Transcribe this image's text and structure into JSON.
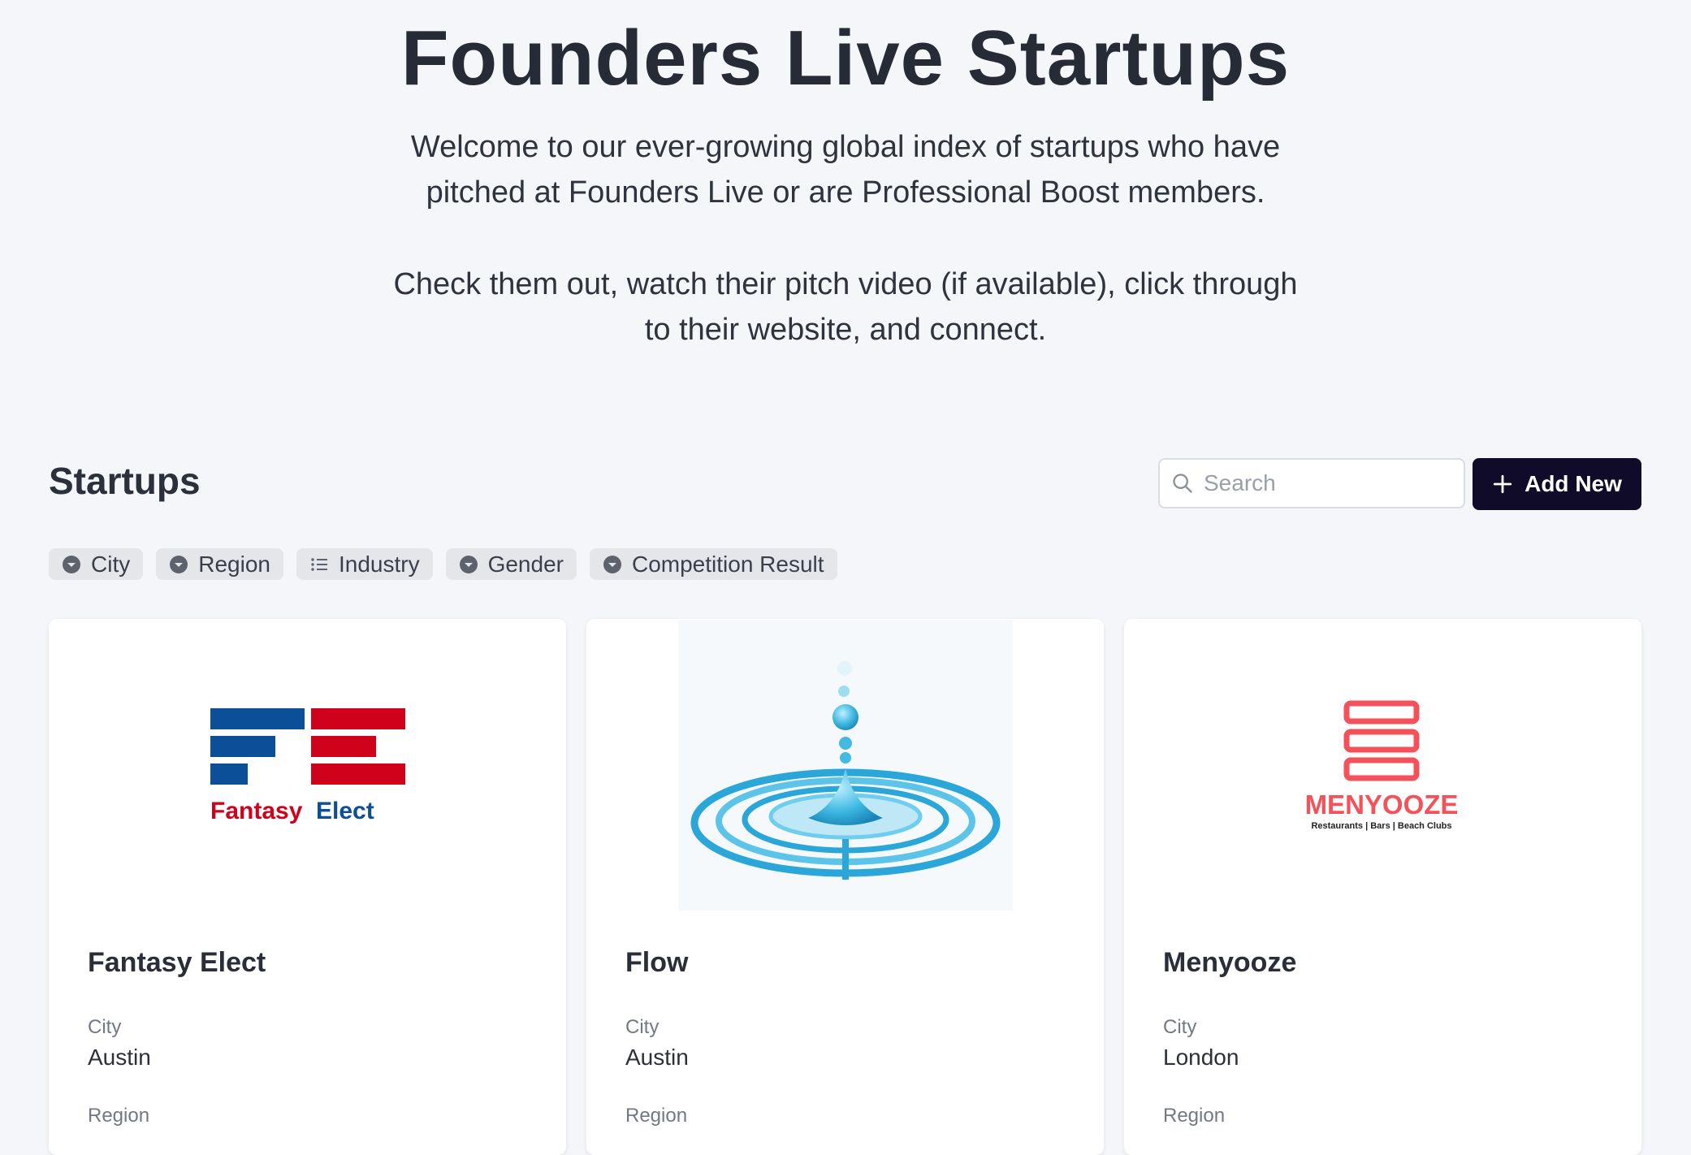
{
  "hero": {
    "title": "Founders Live Startups",
    "intro_line1": "Welcome to our ever-growing global index of startups who have",
    "intro_line2": "pitched at Founders Live or are Professional Boost members.",
    "cta_line1": "Check them out, watch their pitch video (if available), click through",
    "cta_line2": "to their website, and connect."
  },
  "section": {
    "title": "Startups",
    "search_placeholder": "Search",
    "add_button_label": "Add New"
  },
  "filters": [
    {
      "label": "City",
      "icon": "chevron-down-circle-icon"
    },
    {
      "label": "Region",
      "icon": "chevron-down-circle-icon"
    },
    {
      "label": "Industry",
      "icon": "list-icon"
    },
    {
      "label": "Gender",
      "icon": "chevron-down-circle-icon"
    },
    {
      "label": "Competition Result",
      "icon": "chevron-down-circle-icon"
    }
  ],
  "cards": [
    {
      "name": "Fantasy Elect",
      "logo": {
        "word1": "Fantasy",
        "word2": "Elect",
        "color1": "#d0021b",
        "color2": "#0b4f98"
      },
      "city_label": "City",
      "city": "Austin",
      "region_label": "Region"
    },
    {
      "name": "Flow",
      "logo": {
        "image": "water-drop-ripple"
      },
      "city_label": "City",
      "city": "Austin",
      "region_label": "Region"
    },
    {
      "name": "Menyooze",
      "logo": {
        "word": "MENYOOZE",
        "tagline": "Restaurants | Bars | Beach Clubs",
        "color": "#f4525a"
      },
      "city_label": "City",
      "city": "London",
      "region_label": "Region"
    }
  ],
  "colors": {
    "background": "#f5f6f9",
    "button_dark": "#0f0b29",
    "chip": "#e4e6ea"
  }
}
